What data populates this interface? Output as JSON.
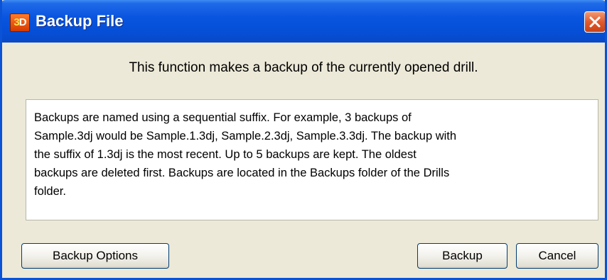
{
  "window": {
    "title": "Backup File",
    "icon": "app-3d-icon",
    "icon_text_a": "3",
    "icon_text_b": "D"
  },
  "titlebar": {
    "close_icon": "close-icon"
  },
  "description": "This function makes a backup of the currently opened drill.",
  "info_text": "Backups are named using a sequential suffix. For example, 3 backups of\nSample.3dj would be Sample.1.3dj, Sample.2.3dj, Sample.3.3dj.  The backup with\nthe suffix of 1.3dj is the most recent.  Up to 5 backups are kept. The oldest\nbackups are deleted first.  Backups are located in the Backups folder of the Drills\nfolder.",
  "buttons": {
    "options": "Backup Options",
    "backup": "Backup",
    "cancel": "Cancel"
  },
  "colors": {
    "titlebar": "#0550d8",
    "dialog_bg": "#ece9d8",
    "close_button": "#e15a2c"
  }
}
